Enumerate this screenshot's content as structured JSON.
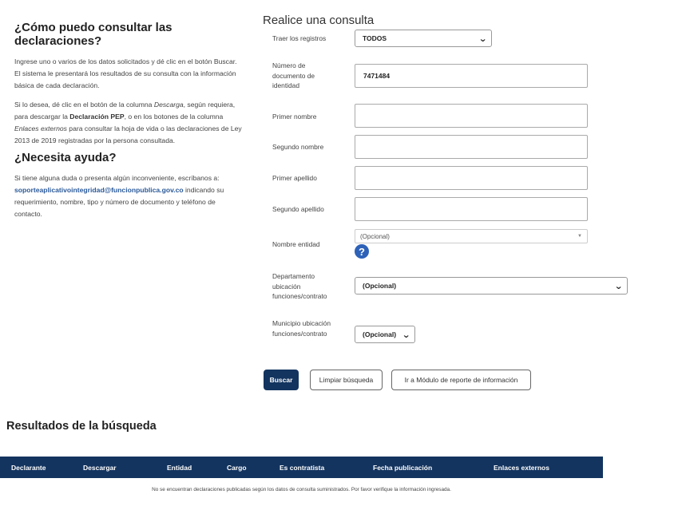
{
  "help": {
    "title": "¿Cómo puedo consultar las declaraciones?",
    "p1": "Ingrese uno o varios de los datos solicitados y dé clic en el botón Buscar. El sistema le presentará los resultados de su consulta con la información básica de cada declaración.",
    "p2_a": "Si lo desea, dé clic en el botón de la columna ",
    "p2_em1": "Descarga",
    "p2_b": ", según requiera, para descargar la ",
    "p2_bold": "Declaración PEP",
    "p2_c": ", o en los botones de la columna ",
    "p2_em2": "Enlaces externos",
    "p2_d": " para consultar la hoja de vida o las declaraciones de Ley 2013 de 2019 registradas por la persona consultada.",
    "help_title": "¿Necesita ayuda?",
    "p3_a": "Si tiene alguna duda o presenta algún inconveniente, escríbanos a: ",
    "p3_email": "soporteaplicativointegridad@funcionpublica.gov.co",
    "p3_b": " indicando su requerimiento, nombre, tipo y número de documento y teléfono de contacto."
  },
  "form": {
    "title": "Realice una consulta",
    "traer_label": "Traer los registros",
    "traer_value": "TODOS",
    "doc_label": "Número de documento de identidad",
    "doc_value": "7471484",
    "primer_nombre_label": "Primer nombre",
    "primer_nombre_value": "",
    "segundo_nombre_label": "Segundo nombre",
    "segundo_nombre_value": "",
    "primer_apellido_label": "Primer apellido",
    "primer_apellido_value": "",
    "segundo_apellido_label": "Segundo apellido",
    "segundo_apellido_value": "",
    "entidad_label": "Nombre entidad",
    "entidad_placeholder": "(Opcional)",
    "departamento_label": "Departamento ubicación funciones/contrato",
    "departamento_value": "(Opcional)",
    "municipio_label": "Municipio ubicación funciones/contrato",
    "municipio_value": "(Opcional)",
    "help_glyph": "?"
  },
  "buttons": {
    "buscar": "Buscar",
    "limpiar": "Limpiar búsqueda",
    "modulo": "Ir a Módulo de reporte de información"
  },
  "results": {
    "title": "Resultados de la búsqueda",
    "columns": [
      "Declarante",
      "Descargar",
      "Entidad",
      "Cargo",
      "Es contratista",
      "Fecha publicación",
      "Enlaces externos"
    ],
    "empty_message": "No se encuentran declaraciones publicadas según los datos de consulta suministrados. Por favor verifique la información ingresada."
  },
  "colors": {
    "primary": "#13345f",
    "link": "#2b5a9a",
    "help_icon": "#2e62b8"
  }
}
